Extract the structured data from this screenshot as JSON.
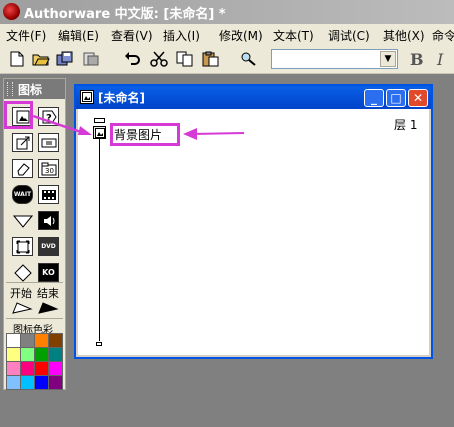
{
  "app": {
    "title": "Authorware 中文版: [未命名] *"
  },
  "menu": [
    "文件(F)",
    "编辑(E)",
    "查看(V)",
    "插入(I)",
    "修改(M)",
    "文本(T)",
    "调试(C)",
    "其他(X)",
    "命令"
  ],
  "toolbar": {
    "buttons": [
      "new-file-icon",
      "open-folder-icon",
      "save-all-icon",
      "import-icon",
      "undo-icon",
      "cut-icon",
      "copy-icon",
      "paste-icon",
      "find-icon"
    ],
    "style_dropdown_value": "",
    "bold_label": "B",
    "italic_label": "I"
  },
  "palette": {
    "title": "图标",
    "icons": [
      "display-icon",
      "interaction-icon",
      "motion-icon",
      "calculation-icon",
      "erase-icon",
      "map-icon",
      "wait-icon",
      "movie-icon",
      "decision-icon",
      "sound-icon",
      "navigate-icon",
      "dvd-video-icon",
      "framework-icon",
      "knowledge-object-icon"
    ],
    "wait_text": "WAIT",
    "dvd_text": "DVD",
    "ko_text": "KO",
    "start_label": "开始",
    "end_label": "结束",
    "color_label": "图标色彩",
    "colors": [
      "#ffffff",
      "#808080",
      "#ff8000",
      "#804000",
      "#ffff80",
      "#80ff80",
      "#00a000",
      "#008080",
      "#ff80c0",
      "#ff0080",
      "#ff0000",
      "#ff00ff",
      "#80c0ff",
      "#00c0ff",
      "#0000ff",
      "#800080"
    ]
  },
  "design_window": {
    "title": "[未命名]",
    "layer": "层 1",
    "icon_label": "背景图片"
  },
  "colors": {
    "highlight": "#d63ad6",
    "window_blue": "#0054e3",
    "close_red": "#e04a2a"
  }
}
